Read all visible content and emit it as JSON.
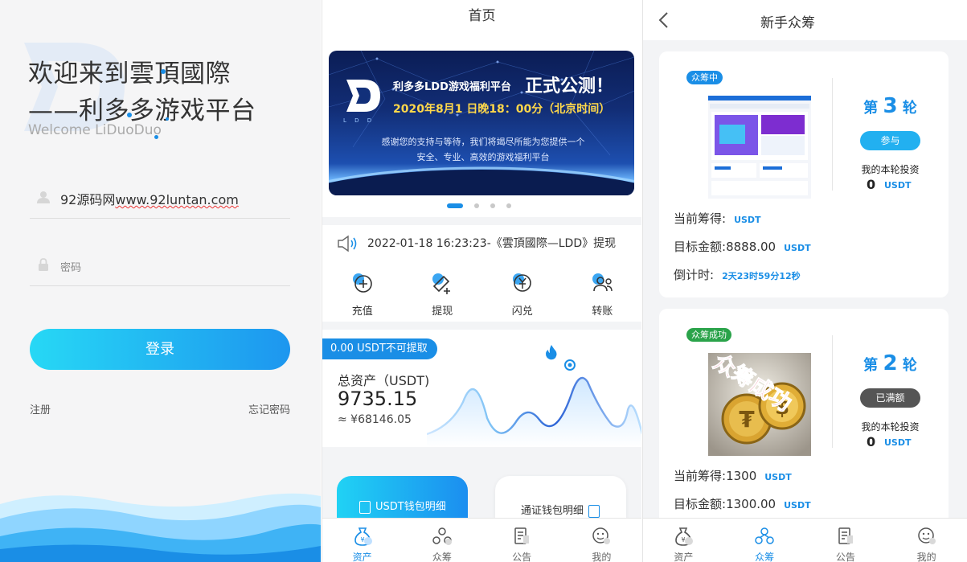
{
  "login": {
    "welcome_line1": "欢迎来到雲頂國際",
    "welcome_line2": "——利多多游戏平台",
    "welcome_en": "Welcome LiDuoDuo",
    "username_prefix": "92源码网",
    "username_link": "www.92luntan.com",
    "password_placeholder": "密码",
    "login_label": "登录",
    "register_label": "注册",
    "forgot_label": "忘记密码",
    "accent": "#1a8ee6"
  },
  "home": {
    "title": "首页",
    "banner": {
      "logo_caption": "L D D",
      "headline": "利多多LDD游戏福利平台",
      "headline_big": "正式公测！",
      "date_line": "2020年8月1 日晚18：00分（北京时间）",
      "body_line1": "感谢您的支持与等待，我们将竭尽所能为您提供一个",
      "body_line2": "安全、专业、高效的游戏福利平台"
    },
    "notice": "2022-01-18 16:23:23-《雲頂國際—LDD》提现",
    "actions": [
      {
        "label": "充值",
        "icon": "recharge-icon"
      },
      {
        "label": "提现",
        "icon": "withdraw-icon"
      },
      {
        "label": "闪兑",
        "icon": "exchange-icon"
      },
      {
        "label": "转账",
        "icon": "transfer-icon"
      }
    ],
    "asset_tag": "0.00 USDT不可提取",
    "asset_label": "总资产（USDT)",
    "asset_value": "9735.15",
    "asset_cny": "≈ ¥68146.05",
    "wallet_usdt": "USDT钱包明细",
    "wallet_pass": "通证钱包明细"
  },
  "tabs": [
    {
      "label": "资产",
      "icon": "asset-icon"
    },
    {
      "label": "众筹",
      "icon": "crowdfund-icon"
    },
    {
      "label": "公告",
      "icon": "notice-icon"
    },
    {
      "label": "我的",
      "icon": "profile-icon"
    }
  ],
  "crowd": {
    "title": "新手众筹",
    "cards": [
      {
        "status": "众筹中",
        "round_prefix": "第",
        "round_num": "3",
        "round_suffix": "轮",
        "button": "参与",
        "my_invest_label": "我的本轮投资",
        "my_invest_value": "0",
        "unit": "USDT",
        "raised_label": "当前筹得:",
        "raised_value": "",
        "target_label": "目标金额:",
        "target_value": "8888.00",
        "countdown_label": "倒计时:",
        "countdown_value": "2天23时59分12秒"
      },
      {
        "status": "众筹成功",
        "round_prefix": "第",
        "round_num": "2",
        "round_suffix": "轮",
        "button": "已满额",
        "my_invest_label": "我的本轮投资",
        "my_invest_value": "0",
        "unit": "USDT",
        "raised_label": "当前筹得:",
        "raised_value": "1300",
        "target_label": "目标金额:",
        "target_value": "1300.00",
        "success_stamp": "众筹成功"
      }
    ]
  }
}
